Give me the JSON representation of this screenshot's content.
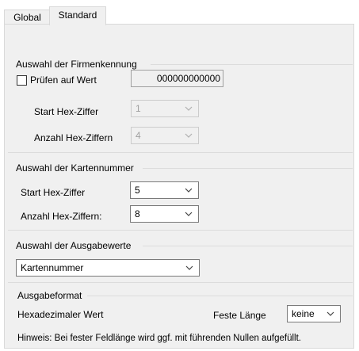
{
  "tabs": [
    {
      "label": "Global"
    },
    {
      "label": "Standard"
    }
  ],
  "firmenkennung": {
    "group_title": "Auswahl der Firmenkennung",
    "check_label": "Prüfen auf Wert",
    "checked": false,
    "value": "000000000000",
    "start_label": "Start Hex-Ziffer",
    "start_value": "1",
    "anzahl_label": "Anzahl Hex-Ziffern",
    "anzahl_value": "4"
  },
  "kartennummer": {
    "group_title": "Auswahl der Kartennummer",
    "start_label": "Start Hex-Ziffer",
    "start_value": "5",
    "anzahl_label": "Anzahl Hex-Ziffern:",
    "anzahl_value": "8"
  },
  "ausgabewerte": {
    "group_title": "Auswahl der Ausgabewerte",
    "selected": "Kartennummer"
  },
  "ausgabeformat": {
    "group_title": "Ausgabeformat",
    "format_label": "Hexadezimaler Wert",
    "feste_laenge_label": "Feste Länge",
    "feste_laenge_value": "keine",
    "hint": "Hinweis: Bei fester Feldlänge wird ggf. mit führenden Nullen aufgefüllt."
  }
}
